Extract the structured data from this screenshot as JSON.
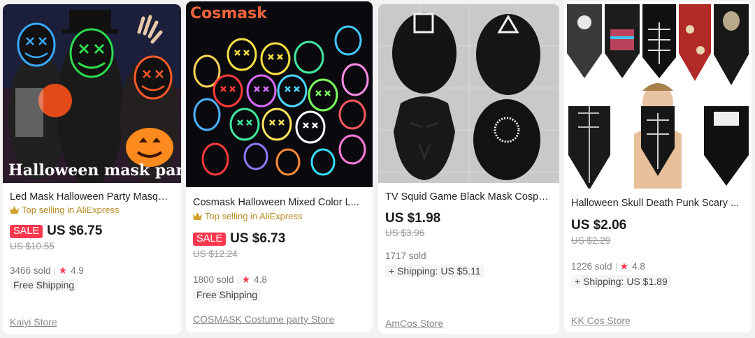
{
  "products": [
    {
      "image_caption": "Halloween mask party",
      "title": "Led Mask Halloween Party Masqu...",
      "badge": "Top selling in AliExpress",
      "sale_label": "SALE",
      "price": "US $6.75",
      "old_price": "US $10.55",
      "sold": "3466 sold",
      "rating": "4.9",
      "shipping": "Free Shipping",
      "store": "Kaiyi Store"
    },
    {
      "image_caption": "Cosmask",
      "title": "Cosmask Halloween Mixed Color L...",
      "badge": "Top selling in AliExpress",
      "sale_label": "SALE",
      "price": "US $6.73",
      "old_price": "US $12.24",
      "sold": "1800 sold",
      "rating": "4.8",
      "shipping": "Free Shipping",
      "store": "COSMASK Costume party Store"
    },
    {
      "title": "TV Squid Game Black Mask Cospla...",
      "price": "US $1.98",
      "old_price": "US $3.96",
      "sold": "1717 sold",
      "shipping": "+ Shipping: US $5.11",
      "store": "AmCos Store"
    },
    {
      "title": "Halloween Skull Death Punk Scary ...",
      "price": "US $2.06",
      "old_price": "US $2.29",
      "sold": "1226 sold",
      "rating": "4.8",
      "shipping": "+ Shipping: US $1.89",
      "store": "KK Cos Store"
    }
  ],
  "icons": {
    "badge": "crown-icon",
    "rating": "star-icon"
  },
  "colors": {
    "sale": "#fd384f",
    "badge_text": "#b98a27",
    "star": "#fd384f"
  }
}
